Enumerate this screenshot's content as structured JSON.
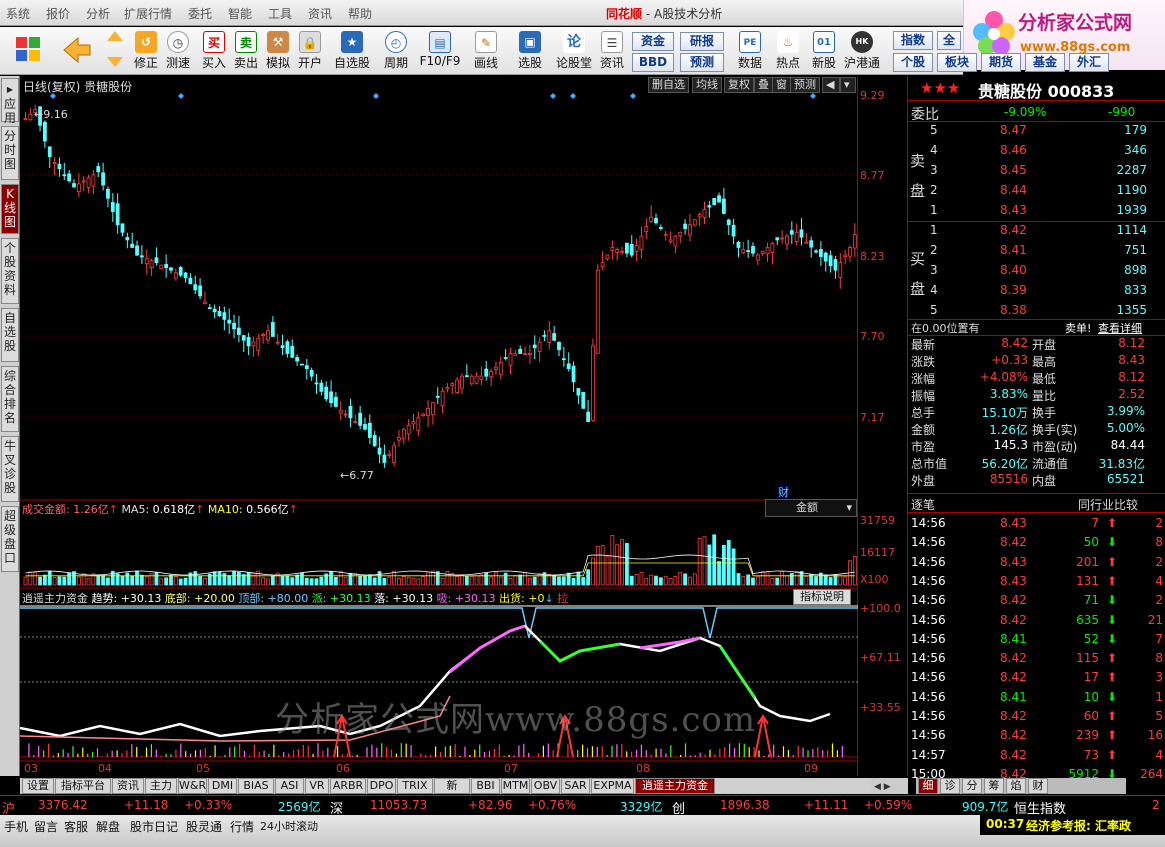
{
  "menu": {
    "items": [
      "系统",
      "报价",
      "分析",
      "扩展行情",
      "委托",
      "智能",
      "工具",
      "资讯",
      "帮助"
    ],
    "brand": "同花顺",
    "app": "A股技术分析"
  },
  "logo": {
    "title": "分析家公式网",
    "url": "www.88gs.com"
  },
  "toolbar": {
    "items": [
      "修正",
      "测速",
      "买入",
      "卖出",
      "模拟",
      "开户",
      "自选股",
      "周期",
      "F10/F9",
      "画线",
      "选股",
      "论股堂",
      "资讯",
      "数据",
      "热点",
      "新股",
      "沪港通"
    ],
    "small": [
      "资金",
      "研报",
      "BBD",
      "预测"
    ],
    "right": [
      "指数",
      "全",
      "个股",
      "板块",
      "期货",
      "基金",
      "外汇"
    ]
  },
  "lefttabs": [
    "应用",
    "分时图",
    "K线图",
    "个股资料",
    "自选股",
    "综合排名",
    "牛叉诊股",
    "超级盘口"
  ],
  "chart": {
    "header_left": "日线(复权)  贵糖股份",
    "header_buttons": [
      "删自选",
      "均线",
      "复权",
      "叠",
      "窗",
      "预测"
    ],
    "price_axis": [
      "9.29",
      "8.77",
      "8.23",
      "7.70",
      "7.17"
    ],
    "high_label": "9.16",
    "low_label": "6.77",
    "cai": "财",
    "vol_header": {
      "name": "成交金额:",
      "val": "1.26亿",
      "ma5_l": "MA5:",
      "ma5": "0.618亿",
      "ma10_l": "MA10:",
      "ma10": "0.566亿"
    },
    "vol_select": "金额",
    "vol_axis": [
      "31759",
      "16117",
      "X100"
    ],
    "ind_header": {
      "name": "逍遥主力资金",
      "qs": "趋势: +30.13",
      "db": "底部: +20.00",
      "dp": "顶部: +80.00",
      "pai": "派: +30.13",
      "luo": "落: +30.13",
      "xi": "吸: +30.13",
      "ch": "出货: +0",
      "la": "拉"
    },
    "ind_button": "指标说明",
    "ind_axis": [
      "+100.0",
      "+67.11",
      "+33.55"
    ],
    "x_labels": [
      "03",
      "04",
      "05",
      "06",
      "07",
      "08",
      "09"
    ],
    "watermark": "分析家公式网www.88gs.com"
  },
  "bottomtabs": [
    "设置",
    "指标平台",
    "资讯",
    "主力",
    "W&R",
    "DMI",
    "BIAS",
    "ASI",
    "VR",
    "ARBR",
    "DPO",
    "TRIX",
    "新DMA",
    "BBI",
    "MTM",
    "OBV",
    "SAR",
    "EXPMA",
    "逍遥主力资金"
  ],
  "minitabs": [
    "细",
    "诊",
    "分",
    "筹",
    "焰",
    "财"
  ],
  "quote": {
    "stars": "★★★",
    "name": "贵糖股份",
    "code": "000833",
    "weibi_l": "委比",
    "weibi": "-9.09%",
    "weicha": "-990",
    "sell_label": "卖盘",
    "buy_label": "买盘",
    "sells": [
      {
        "n": "5",
        "p": "8.47",
        "v": "179"
      },
      {
        "n": "4",
        "p": "8.46",
        "v": "346"
      },
      {
        "n": "3",
        "p": "8.45",
        "v": "2287"
      },
      {
        "n": "2",
        "p": "8.44",
        "v": "1190"
      },
      {
        "n": "1",
        "p": "8.43",
        "v": "1939"
      }
    ],
    "buys": [
      {
        "n": "1",
        "p": "8.42",
        "v": "1114"
      },
      {
        "n": "2",
        "p": "8.41",
        "v": "751"
      },
      {
        "n": "3",
        "p": "8.40",
        "v": "898"
      },
      {
        "n": "4",
        "p": "8.39",
        "v": "833"
      },
      {
        "n": "5",
        "p": "8.38",
        "v": "1355"
      }
    ],
    "pos": "在0.00位置有",
    "dan": "卖单!",
    "detail": "查看详细",
    "stats": [
      {
        "l": "最新",
        "v": "8.42",
        "l2": "开盘",
        "v2": "8.12"
      },
      {
        "l": "涨跌",
        "v": "+0.33",
        "l2": "最高",
        "v2": "8.43"
      },
      {
        "l": "涨幅",
        "v": "+4.08%",
        "l2": "最低",
        "v2": "8.12"
      },
      {
        "l": "振幅",
        "v": "3.83%",
        "l2": "量比",
        "v2": "2.52"
      },
      {
        "l": "总手",
        "v": "15.10万",
        "l2": "换手",
        "v2": "3.99%"
      },
      {
        "l": "金额",
        "v": "1.26亿",
        "l2": "换手(实)",
        "v2": "5.00%"
      },
      {
        "l": "市盈",
        "v": "145.3",
        "l2": "市盈(动)",
        "v2": "84.44"
      },
      {
        "l": "总市值",
        "v": "56.20亿",
        "l2": "流通值",
        "v2": "31.83亿"
      },
      {
        "l": "外盘",
        "v": "85516",
        "l2": "内盘",
        "v2": "65521"
      }
    ],
    "ticks_l": "逐笔",
    "ticks_r": "同行业比较",
    "ticks": [
      {
        "t": "14:56",
        "p": "8.43",
        "v": "7",
        "d": "up",
        "x": "2"
      },
      {
        "t": "14:56",
        "p": "8.42",
        "v": "50",
        "d": "dn",
        "x": "8"
      },
      {
        "t": "14:56",
        "p": "8.43",
        "v": "201",
        "d": "up",
        "x": "2"
      },
      {
        "t": "14:56",
        "p": "8.43",
        "v": "131",
        "d": "up",
        "x": "4"
      },
      {
        "t": "14:56",
        "p": "8.42",
        "v": "71",
        "d": "dn",
        "x": "2"
      },
      {
        "t": "14:56",
        "p": "8.42",
        "v": "635",
        "d": "dn",
        "x": "21"
      },
      {
        "t": "14:56",
        "p": "8.41",
        "v": "52",
        "d": "dn",
        "x": "7"
      },
      {
        "t": "14:56",
        "p": "8.42",
        "v": "115",
        "d": "up",
        "x": "8"
      },
      {
        "t": "14:56",
        "p": "8.42",
        "v": "17",
        "d": "up",
        "x": "3"
      },
      {
        "t": "14:56",
        "p": "8.41",
        "v": "10",
        "d": "dn",
        "x": "1"
      },
      {
        "t": "14:56",
        "p": "8.42",
        "v": "60",
        "d": "up",
        "x": "5"
      },
      {
        "t": "14:56",
        "p": "8.42",
        "v": "239",
        "d": "up",
        "x": "16"
      },
      {
        "t": "14:57",
        "p": "8.42",
        "v": "73",
        "d": "up",
        "x": "4"
      },
      {
        "t": "15:00",
        "p": "8.42",
        "v": "5912",
        "d": "dn",
        "x": "264"
      }
    ]
  },
  "status": {
    "sh": "沪",
    "sh_v": "3376.42",
    "sh_c": "+11.18",
    "sh_p": "+0.33%",
    "sh_amt": "2569亿",
    "sz": "深",
    "sz_v": "11053.73",
    "sz_c": "+82.96",
    "sz_p": "+0.76%",
    "sz_amt": "3329亿",
    "cy": "创",
    "cy_v": "1896.38",
    "cy_c": "+11.11",
    "cy_p": "+0.59%",
    "hk_amt": "909.7亿",
    "hk": "恒生指数",
    "hk_v": "2"
  },
  "taskbar": {
    "items": [
      "手机",
      "留言",
      "客服",
      "解盘",
      "股市日记",
      "股灵通",
      "行情",
      "24小时滚动"
    ],
    "time": "00:37",
    "news": "经济参考报: 汇率政"
  },
  "colors": {
    "up": "#ff3b3b",
    "down": "#5ff",
    "bg": "#000000",
    "border": "#aa0000",
    "grid": "#770000"
  }
}
